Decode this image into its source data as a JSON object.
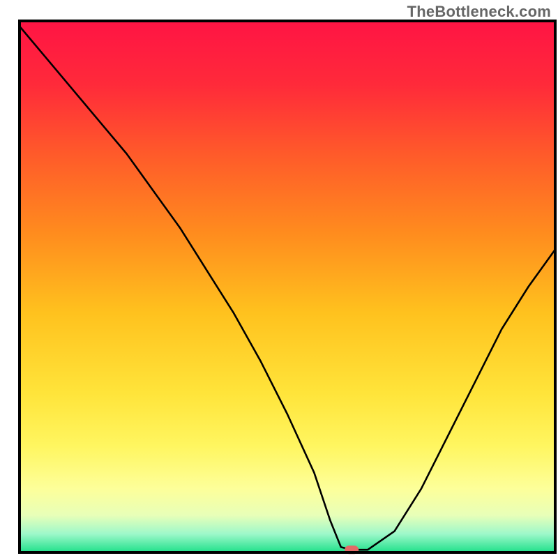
{
  "watermark": "TheBottleneck.com",
  "chart_data": {
    "type": "line",
    "title": "",
    "xlabel": "",
    "ylabel": "",
    "xlim": [
      0,
      100
    ],
    "ylim": [
      0,
      100
    ],
    "grid": false,
    "legend": false,
    "x": [
      0,
      5,
      10,
      15,
      20,
      25,
      30,
      35,
      40,
      45,
      50,
      55,
      58,
      60,
      62,
      65,
      70,
      75,
      80,
      85,
      90,
      95,
      100
    ],
    "values": [
      99,
      93,
      87,
      81,
      75,
      68,
      61,
      53,
      45,
      36,
      26,
      15,
      6,
      1,
      0.5,
      0.5,
      4,
      12,
      22,
      32,
      42,
      50,
      57
    ],
    "minimum_marker": {
      "x": 62,
      "y": 0.5
    },
    "gradient_stops": [
      {
        "pos": 0.0,
        "color": "#ff1444"
      },
      {
        "pos": 0.12,
        "color": "#ff2a3a"
      },
      {
        "pos": 0.25,
        "color": "#ff5a2a"
      },
      {
        "pos": 0.4,
        "color": "#ff8c1e"
      },
      {
        "pos": 0.55,
        "color": "#ffc21e"
      },
      {
        "pos": 0.7,
        "color": "#ffe43a"
      },
      {
        "pos": 0.8,
        "color": "#fff660"
      },
      {
        "pos": 0.88,
        "color": "#fdff9a"
      },
      {
        "pos": 0.93,
        "color": "#e8ffb8"
      },
      {
        "pos": 0.965,
        "color": "#9ef8ca"
      },
      {
        "pos": 1.0,
        "color": "#1fe08a"
      }
    ],
    "frame_color": "#000000",
    "line_color": "#000000",
    "marker_color": "#e46a66"
  }
}
